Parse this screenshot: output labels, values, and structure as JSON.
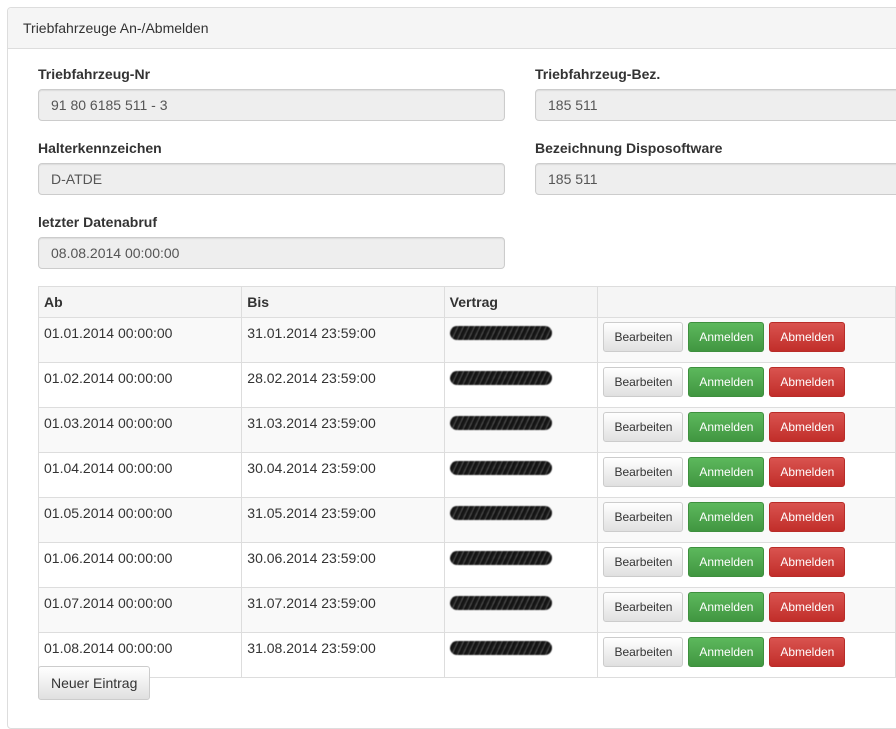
{
  "panel": {
    "title": "Triebfahrzeuge An-/Abmelden"
  },
  "form": {
    "nr_label": "Triebfahrzeug-Nr",
    "nr_value": "91 80 6185 511 - 3",
    "bez_label": "Triebfahrzeug-Bez.",
    "bez_value": "185 511",
    "halter_label": "Halterkennzeichen",
    "halter_value": "D-ATDE",
    "dispo_label": "Bezeichnung Disposoftware",
    "dispo_value": "185 511",
    "abruf_label": "letzter Datenabruf",
    "abruf_value": "08.08.2014 00:00:00"
  },
  "table": {
    "headers": [
      "Ab",
      "Bis",
      "Vertrag",
      ""
    ],
    "rows": [
      {
        "ab": "01.01.2014 00:00:00",
        "bis": "31.01.2014 23:59:00"
      },
      {
        "ab": "01.02.2014 00:00:00",
        "bis": "28.02.2014 23:59:00"
      },
      {
        "ab": "01.03.2014 00:00:00",
        "bis": "31.03.2014 23:59:00"
      },
      {
        "ab": "01.04.2014 00:00:00",
        "bis": "30.04.2014 23:59:00"
      },
      {
        "ab": "01.05.2014 00:00:00",
        "bis": "31.05.2014 23:59:00"
      },
      {
        "ab": "01.06.2014 00:00:00",
        "bis": "30.06.2014 23:59:00"
      },
      {
        "ab": "01.07.2014 00:00:00",
        "bis": "31.07.2014 23:59:00"
      },
      {
        "ab": "01.08.2014 00:00:00",
        "bis": "31.08.2014 23:59:00"
      }
    ],
    "edit_label": "Bearbeiten",
    "anmelden_label": "Anmelden",
    "abmelden_label": "Abmelden"
  },
  "new_entry_label": "Neuer Eintrag",
  "colors": {
    "success": "#5cb85c",
    "danger": "#d9534f",
    "readonly_bg": "#eeeeee"
  }
}
